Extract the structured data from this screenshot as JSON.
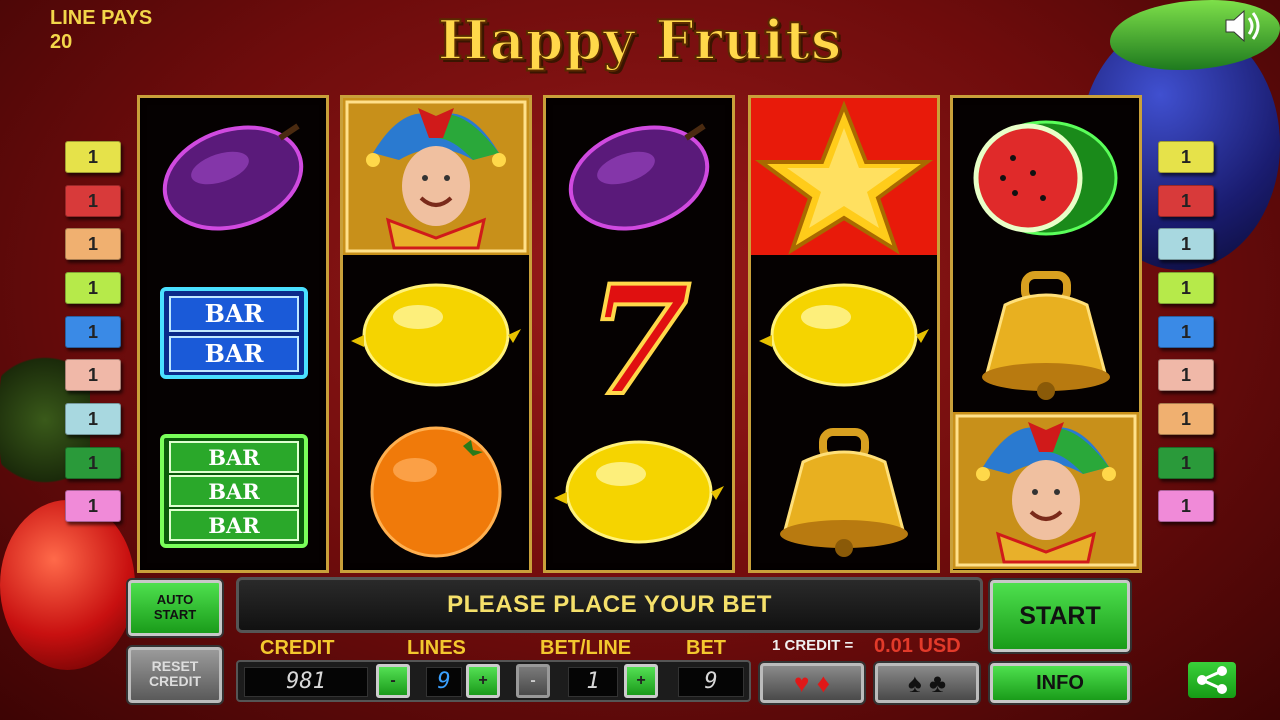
{
  "header": {
    "line_pays_label": "LINE PAYS",
    "line_pays_value": "20",
    "title": "Happy Fruits",
    "sound_icon": "speaker-icon"
  },
  "reels": [
    [
      "plum",
      "bar-double-blue",
      "bar-triple-green"
    ],
    [
      "jester",
      "lemon",
      "orange"
    ],
    [
      "plum",
      "seven",
      "lemon"
    ],
    [
      "star",
      "lemon",
      "bell"
    ],
    [
      "watermelon",
      "bell",
      "jester"
    ]
  ],
  "bar_text": "BAR",
  "seven_text": "7",
  "line_indicators_left": [
    {
      "label": "1",
      "color": "#e6e24a"
    },
    {
      "label": "1",
      "color": "#d83a3a"
    },
    {
      "label": "1",
      "color": "#f0b070"
    },
    {
      "label": "1",
      "color": "#b6ea4a"
    },
    {
      "label": "1",
      "color": "#3a8ae6"
    },
    {
      "label": "1",
      "color": "#f0b8a8"
    },
    {
      "label": "1",
      "color": "#a8d8e0"
    },
    {
      "label": "1",
      "color": "#2a9a3a"
    },
    {
      "label": "1",
      "color": "#f08ad8"
    }
  ],
  "line_indicators_right": [
    {
      "label": "1",
      "color": "#e6e24a"
    },
    {
      "label": "1",
      "color": "#d83a3a"
    },
    {
      "label": "1",
      "color": "#a8d8e0"
    },
    {
      "label": "1",
      "color": "#b6ea4a"
    },
    {
      "label": "1",
      "color": "#3a8ae6"
    },
    {
      "label": "1",
      "color": "#f0b8a8"
    },
    {
      "label": "1",
      "color": "#f0b070"
    },
    {
      "label": "1",
      "color": "#2a9a3a"
    },
    {
      "label": "1",
      "color": "#f08ad8"
    }
  ],
  "controls": {
    "auto_start": "AUTO\nSTART",
    "auto_start_line1": "AUTO",
    "auto_start_line2": "START",
    "reset_line1": "RESET",
    "reset_line2": "CREDIT",
    "message": "PLEASE PLACE YOUR BET",
    "start": "START",
    "info": "INFO",
    "credit_label": "CREDIT",
    "lines_label": "LINES",
    "betline_label": "BET/LINE",
    "bet_label": "BET",
    "credit_value": "981",
    "lines_value": "9",
    "betline_value": "1",
    "bet_value": "9",
    "minus": "-",
    "plus": "+",
    "credit_rate_label": "1 CREDIT =",
    "credit_rate_value": "0.01 USD",
    "red_suits": "♥ ♦",
    "black_suits": "♠ ♣"
  }
}
